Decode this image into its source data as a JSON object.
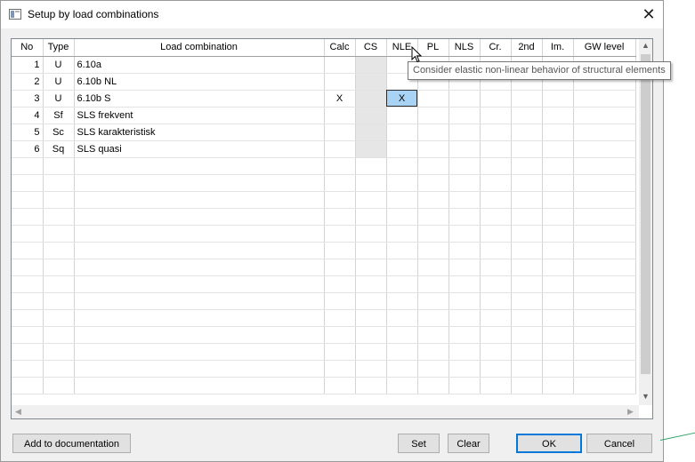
{
  "window": {
    "title": "Setup by load combinations",
    "close_glyph": "✕"
  },
  "grid": {
    "columns": [
      "No",
      "Type",
      "Load combination",
      "Calc",
      "CS",
      "NLE",
      "PL",
      "NLS",
      "Cr.",
      "2nd",
      "Im.",
      "GW level"
    ],
    "rows": [
      {
        "no": "1",
        "type": "U",
        "name": "6.10a",
        "calc": "",
        "nle": ""
      },
      {
        "no": "2",
        "type": "U",
        "name": "6.10b NL",
        "calc": "",
        "nle": ""
      },
      {
        "no": "3",
        "type": "U",
        "name": "6.10b S",
        "calc": "X",
        "nle": "X"
      },
      {
        "no": "4",
        "type": "Sf",
        "name": "SLS frekvent",
        "calc": "",
        "nle": ""
      },
      {
        "no": "5",
        "type": "Sc",
        "name": "SLS karakteristisk",
        "calc": "",
        "nle": ""
      },
      {
        "no": "6",
        "type": "Sq",
        "name": "SLS quasi",
        "calc": "",
        "nle": ""
      }
    ],
    "selected_cell": {
      "row": 3,
      "column": "NLE"
    }
  },
  "tooltip": {
    "text": "Consider elastic non-linear behavior of structural elements"
  },
  "buttons": {
    "add_to_documentation": "Add to documentation",
    "set": "Set",
    "clear": "Clear",
    "ok": "OK",
    "cancel": "Cancel"
  },
  "icons": {
    "app": "dialog-app-icon",
    "close": "close-icon",
    "scroll_up": "scroll-up-arrow",
    "scroll_down": "scroll-down-arrow",
    "scroll_left": "scroll-left-arrow",
    "scroll_right": "scroll-right-arrow",
    "cursor": "mouse-pointer-icon"
  },
  "colors": {
    "selected_cell": "#a9d3f5",
    "cs_column_shade": "#e6e6e6",
    "default_button_border": "#0078d7"
  }
}
